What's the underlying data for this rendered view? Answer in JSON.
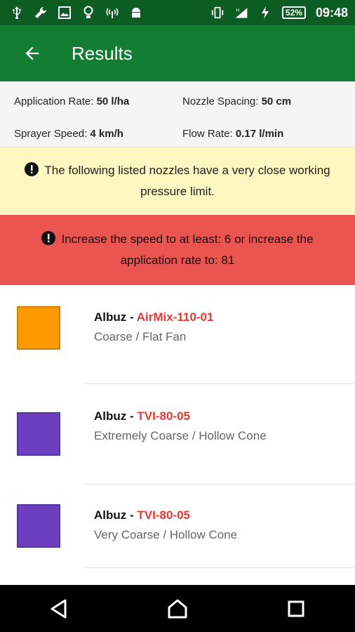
{
  "status_bar": {
    "time": "09:48",
    "battery": "52%"
  },
  "app_bar": {
    "title": "Results"
  },
  "summary": {
    "application_rate_label": "Application Rate:",
    "application_rate_value": "50 l/ha",
    "nozzle_spacing_label": "Nozzle Spacing:",
    "nozzle_spacing_value": "50 cm",
    "sprayer_speed_label": "Sprayer Speed:",
    "sprayer_speed_value": "4 km/h",
    "flow_rate_label": "Flow Rate:",
    "flow_rate_value": "0.17 l/min"
  },
  "warning_message": "The following listed nozzles have a very close working pressure limit.",
  "error_message": "Increase the speed to at least: 6 or increase the application rate to: 81",
  "nozzles": [
    {
      "brand": "Albuz",
      "separator": " - ",
      "model": "AirMix-110-01",
      "description": "Coarse / Flat Fan",
      "color": "#ff9900"
    },
    {
      "brand": "Albuz",
      "separator": " - ",
      "model": "TVI-80-05",
      "description": "Extremely Coarse / Hollow Cone",
      "color": "#6b3fc0"
    },
    {
      "brand": "Albuz",
      "separator": " - ",
      "model": "TVI-80-05",
      "description": "Very Coarse / Hollow Cone",
      "color": "#6b3fc0"
    }
  ],
  "colors": {
    "status_bar": "#0d5c24",
    "app_bar": "#137d34",
    "warning_bg": "#fff7c2",
    "error_bg": "#ea5552",
    "model_text": "#e53935"
  },
  "icons": {
    "back": "arrow-left-icon",
    "alert": "exclamation-circle-icon",
    "nav_back": "triangle-back-icon",
    "nav_home": "home-icon",
    "nav_recent": "square-recent-icon"
  }
}
